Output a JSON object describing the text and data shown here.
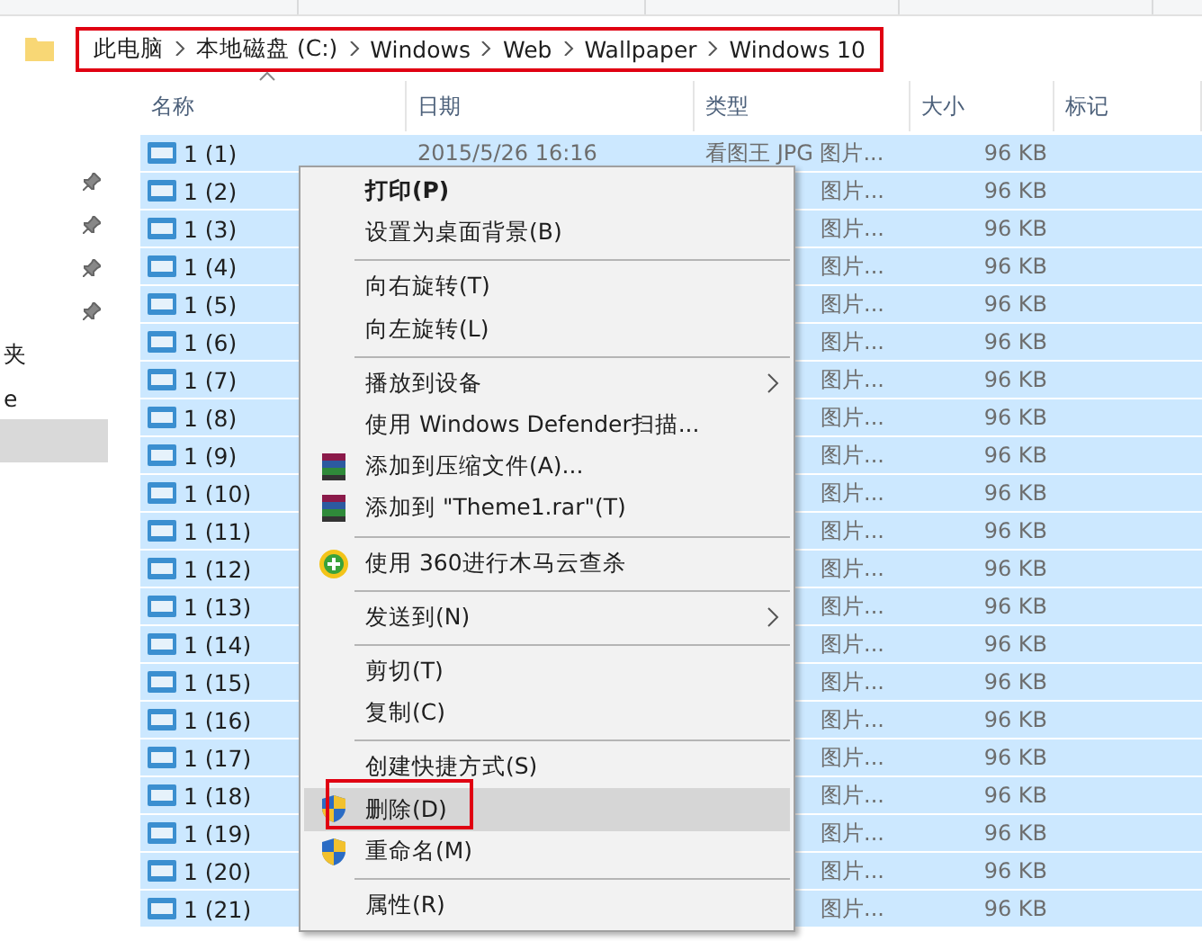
{
  "breadcrumb": {
    "highlighted": true,
    "segments": [
      "此电脑",
      "本地磁盘 (C:)",
      "Windows",
      "Web",
      "Wallpaper",
      "Windows 10"
    ]
  },
  "nav": {
    "items": [
      {
        "label": "夹",
        "selected": false
      },
      {
        "label": "e",
        "selected": false
      },
      {
        "selected": true
      }
    ]
  },
  "columns": [
    "名称",
    "日期",
    "类型",
    "大小",
    "标记"
  ],
  "rows": [
    {
      "name": "1 (1)",
      "date": "2015/5/26 16:16",
      "type": "看图王 JPG 图片...",
      "size": "96 KB",
      "selected": true
    },
    {
      "name": "1 (2)",
      "type": "图片...",
      "size": "96 KB",
      "selected": true
    },
    {
      "name": "1 (3)",
      "type": "图片...",
      "size": "96 KB",
      "selected": true
    },
    {
      "name": "1 (4)",
      "type": "图片...",
      "size": "96 KB",
      "selected": true
    },
    {
      "name": "1 (5)",
      "type": "图片...",
      "size": "96 KB",
      "selected": true
    },
    {
      "name": "1 (6)",
      "type": "图片...",
      "size": "96 KB",
      "selected": true
    },
    {
      "name": "1 (7)",
      "type": "图片...",
      "size": "96 KB",
      "selected": true
    },
    {
      "name": "1 (8)",
      "type": "图片...",
      "size": "96 KB",
      "selected": true
    },
    {
      "name": "1 (9)",
      "type": "图片...",
      "size": "96 KB",
      "selected": true
    },
    {
      "name": "1 (10)",
      "type": "图片...",
      "size": "96 KB",
      "selected": true
    },
    {
      "name": "1 (11)",
      "type": "图片...",
      "size": "96 KB",
      "selected": true
    },
    {
      "name": "1 (12)",
      "type": "图片...",
      "size": "96 KB",
      "selected": true
    },
    {
      "name": "1 (13)",
      "type": "图片...",
      "size": "96 KB",
      "selected": true
    },
    {
      "name": "1 (14)",
      "type": "图片...",
      "size": "96 KB",
      "selected": true
    },
    {
      "name": "1 (15)",
      "type": "图片...",
      "size": "96 KB",
      "selected": true
    },
    {
      "name": "1 (16)",
      "type": "图片...",
      "size": "96 KB",
      "selected": true
    },
    {
      "name": "1 (17)",
      "type": "图片...",
      "size": "96 KB",
      "selected": true
    },
    {
      "name": "1 (18)",
      "type": "图片...",
      "size": "96 KB",
      "selected": true
    },
    {
      "name": "1 (19)",
      "type": "图片...",
      "size": "96 KB",
      "selected": true
    },
    {
      "name": "1 (20)",
      "type": "图片...",
      "size": "96 KB",
      "selected": true
    },
    {
      "name": "1 (21)",
      "type": "图片...",
      "size": "96 KB",
      "selected": true
    }
  ],
  "context_menu": [
    {
      "kind": "item",
      "label": "打印(P)",
      "bold": true,
      "selected": false
    },
    {
      "kind": "item",
      "label": "设置为桌面背景(B)",
      "selected": false
    },
    {
      "kind": "separator"
    },
    {
      "kind": "item",
      "label": "向右旋转(T)",
      "selected": false
    },
    {
      "kind": "item",
      "label": "向左旋转(L)",
      "selected": false
    },
    {
      "kind": "separator"
    },
    {
      "kind": "item",
      "label": "播放到设备",
      "submenu": true,
      "selected": false
    },
    {
      "kind": "item",
      "label": "使用 Windows Defender扫描...",
      "selected": false
    },
    {
      "kind": "archive",
      "label": "添加到压缩文件(A)...",
      "selected": false
    },
    {
      "kind": "archive",
      "label": "添加到 \"Theme1.rar\"(T)",
      "selected": false
    },
    {
      "kind": "separator"
    },
    {
      "kind": "antivirus",
      "label": "使用 360进行木马云查杀",
      "selected": false
    },
    {
      "kind": "separator"
    },
    {
      "kind": "item",
      "label": "发送到(N)",
      "submenu": true,
      "selected": false
    },
    {
      "kind": "separator"
    },
    {
      "kind": "item",
      "label": "剪切(T)",
      "selected": false
    },
    {
      "kind": "item",
      "label": "复制(C)",
      "selected": false
    },
    {
      "kind": "separator"
    },
    {
      "kind": "item",
      "label": "创建快捷方式(S)",
      "selected": false
    },
    {
      "kind": "admin",
      "label": "删除(D)",
      "selected": true,
      "highlighted": true
    },
    {
      "kind": "admin",
      "label": "重命名(M)",
      "selected": false
    },
    {
      "kind": "separator"
    },
    {
      "kind": "item",
      "label": "属性(R)",
      "selected": false
    }
  ]
}
